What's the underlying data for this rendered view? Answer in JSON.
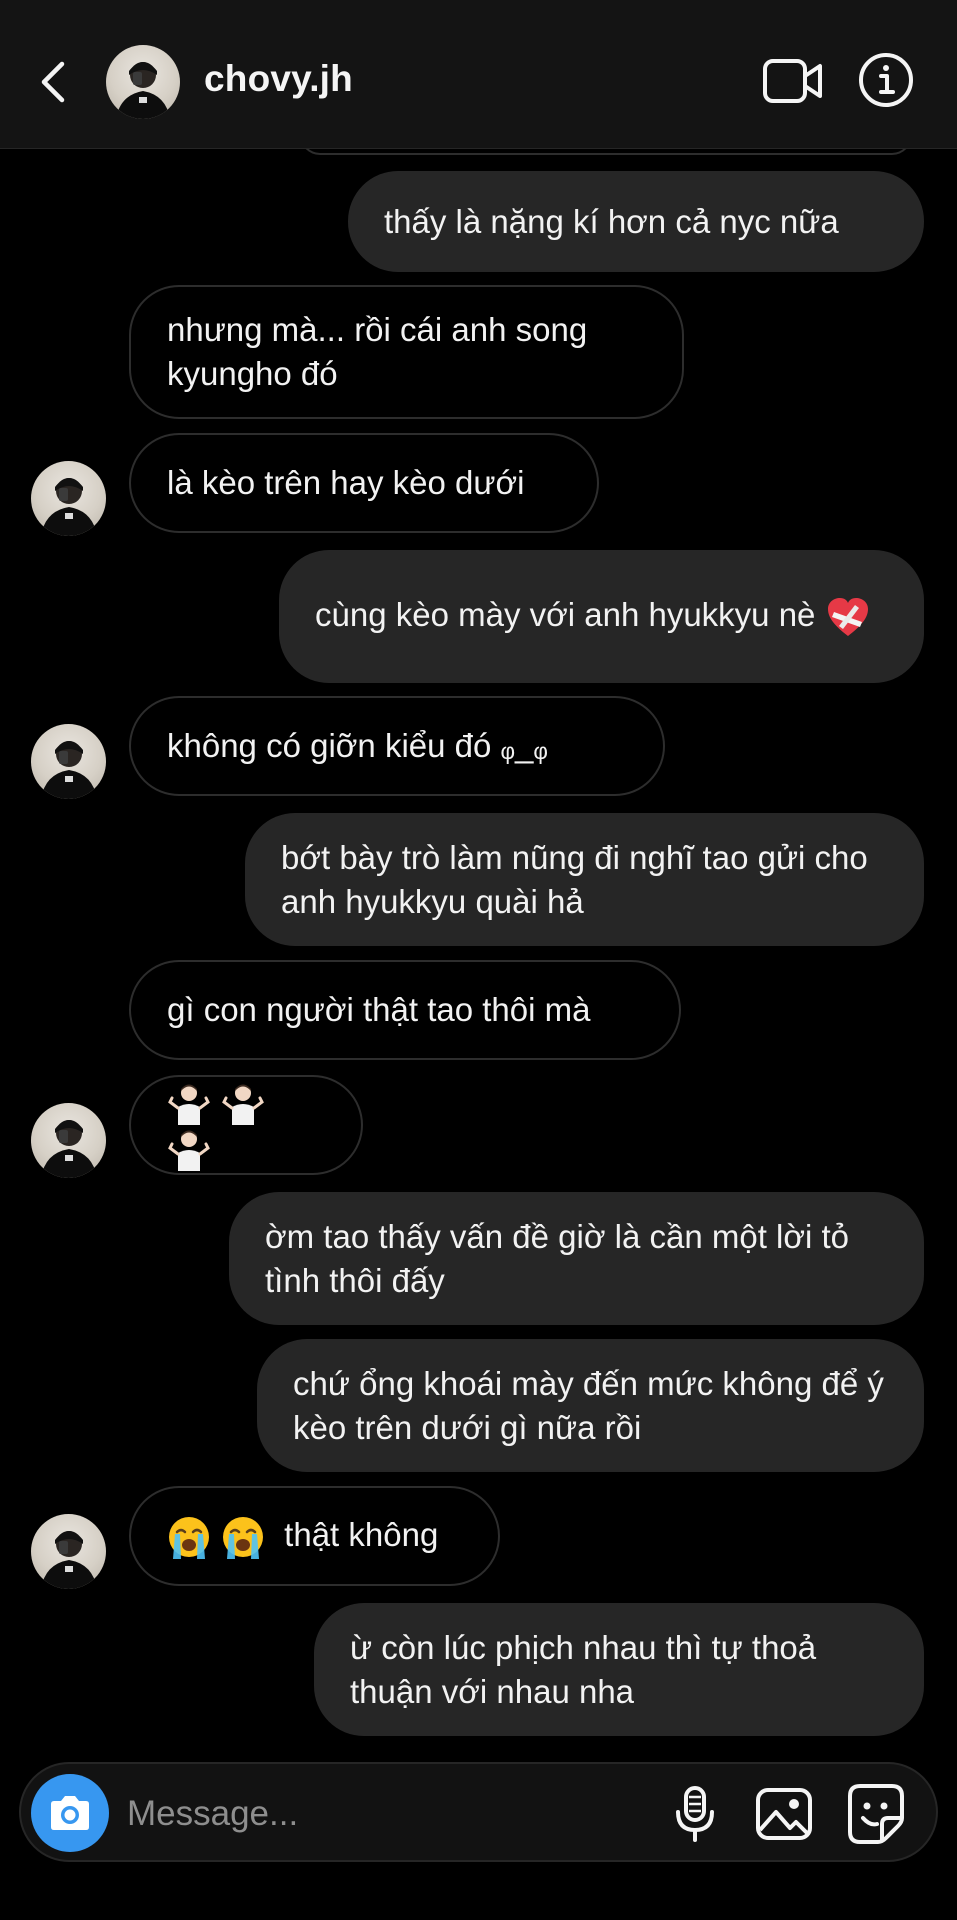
{
  "header": {
    "username": "chovy.jh"
  },
  "messages": [
    {
      "from": "me",
      "text": "thấy là nặng kí hơn cả nyc nữa"
    },
    {
      "from": "them",
      "text": "nhưng mà... rồi cái anh song kyungho đó"
    },
    {
      "from": "them",
      "text": "là kèo trên hay kèo dưới"
    },
    {
      "from": "me",
      "text": "cùng kèo mày với anh hyukkyu nè",
      "trailing_emoji": "heart-icon"
    },
    {
      "from": "them",
      "text": "không có giỡn kiểu đó ᵩ_ᵩ"
    },
    {
      "from": "me",
      "text": "bớt bày trò làm nũng đi nghĩ tao gửi cho anh hyukkyu quài hả"
    },
    {
      "from": "them",
      "text": "gì con người thật tao thôi mà"
    },
    {
      "from": "them",
      "text": "",
      "emojis": [
        "person-shrugging-icon",
        "person-shrugging-icon",
        "person-shrugging-icon"
      ]
    },
    {
      "from": "me",
      "text": "ờm tao thấy vấn đề giờ là cần một lời tỏ tình thôi đấy"
    },
    {
      "from": "me",
      "text": "chứ ổng khoái mày đến mức không để ý kèo trên dưới gì nữa rồi"
    },
    {
      "from": "them",
      "text": "thật không",
      "emojis": [
        "loudly-crying-face-icon",
        "loudly-crying-face-icon"
      ]
    },
    {
      "from": "me",
      "text": "ừ còn lúc phịch nhau thì tự thoả thuận với nhau nha"
    }
  ],
  "composer": {
    "placeholder": "Message...",
    "value": ""
  },
  "colors": {
    "background": "#000000",
    "header": "#141414",
    "outgoing_bubble": "#262626",
    "incoming_border": "#2d2d2d",
    "accent": "#3797f0",
    "text": "#f2f2f2",
    "placeholder": "#8e8e8e"
  },
  "icons": {
    "back": "chevron-left-icon",
    "video": "video-camera-icon",
    "info": "info-icon",
    "camera": "camera-icon",
    "mic": "microphone-icon",
    "gallery": "image-icon",
    "sticker": "sticker-icon"
  }
}
